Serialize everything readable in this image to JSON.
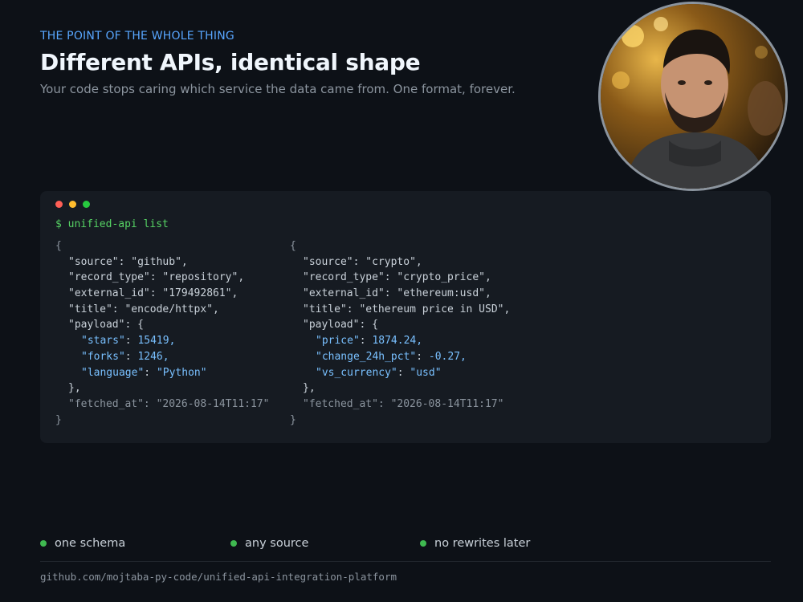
{
  "header": {
    "eyebrow": "THE POINT OF THE WHOLE THING",
    "title": "Different APIs, identical shape",
    "subtitle": "Your code stops caring which service the data came from. One format, forever."
  },
  "terminal": {
    "prompt": "$ unified-api list",
    "left": {
      "open": "{",
      "source_key": "\"source\"",
      "source_val": "\"github\",",
      "record_type_key": "\"record_type\"",
      "record_type_val": "\"repository\",",
      "external_id_key": "\"external_id\"",
      "external_id_val": "\"179492861\",",
      "title_key": "\"title\"",
      "title_val": "\"encode/httpx\",",
      "payload_key": "\"payload\"",
      "payload_open": "{",
      "p1_key": "\"stars\"",
      "p1_val": "15419,",
      "p2_key": "\"forks\"",
      "p2_val": "1246,",
      "p3_key": "\"language\"",
      "p3_val": "\"Python\"",
      "payload_close": "},",
      "fetched_key": "\"fetched_at\"",
      "fetched_val": "\"2026-08-14T11:17\"",
      "close": "}"
    },
    "right": {
      "open": "{",
      "source_key": "\"source\"",
      "source_val": "\"crypto\",",
      "record_type_key": "\"record_type\"",
      "record_type_val": "\"crypto_price\",",
      "external_id_key": "\"external_id\"",
      "external_id_val": "\"ethereum:usd\",",
      "title_key": "\"title\"",
      "title_val": "\"ethereum price in USD\",",
      "payload_key": "\"payload\"",
      "payload_open": "{",
      "p1_key": "\"price\"",
      "p1_val": "1874.24,",
      "p2_key": "\"change_24h_pct\"",
      "p2_val": "-0.27,",
      "p3_key": "\"vs_currency\"",
      "p3_val": "\"usd\"",
      "payload_close": "},",
      "fetched_key": "\"fetched_at\"",
      "fetched_val": "\"2026-08-14T11:17\"",
      "close": "}"
    }
  },
  "features": [
    "one schema",
    "any source",
    "no rewrites later"
  ],
  "footer": {
    "repo": "github.com/mojtaba-py-code/unified-api-integration-platform"
  },
  "colors": {
    "accent": "#58a6ff",
    "bullet": "#3fb950",
    "prompt": "#56d364",
    "payload": "#79c0ff"
  }
}
